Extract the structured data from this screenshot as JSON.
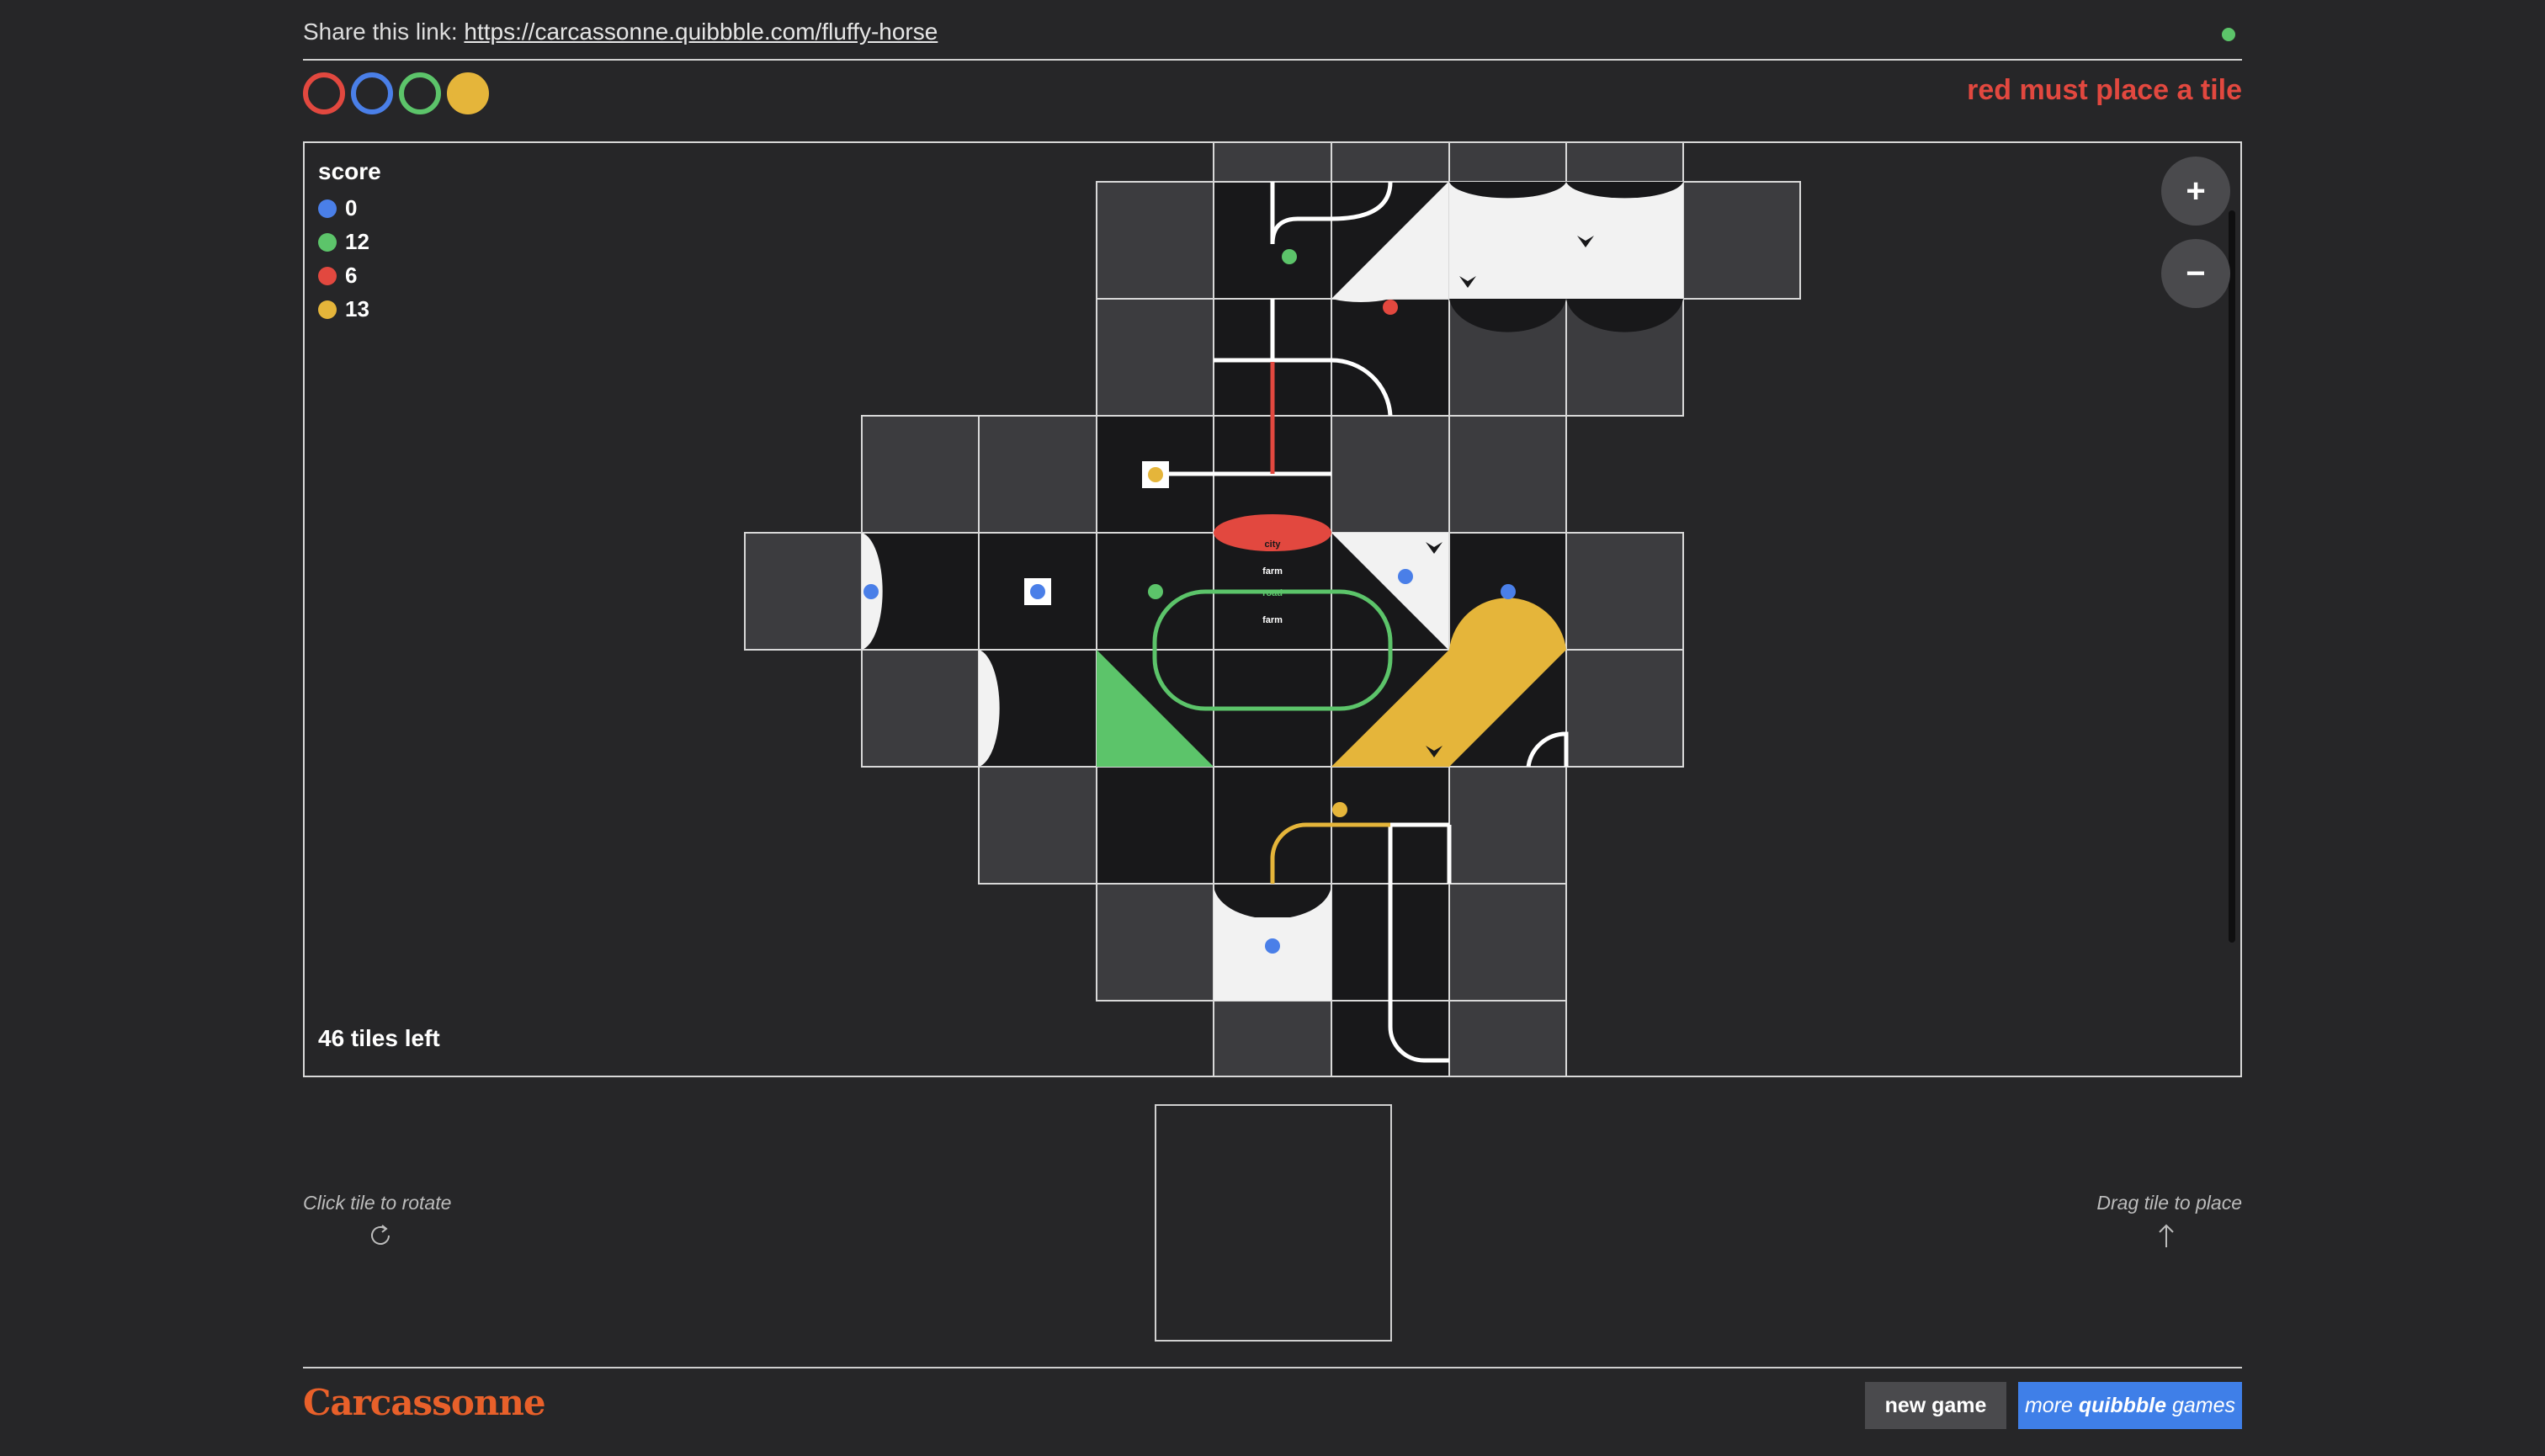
{
  "share": {
    "prefix": "Share this link: ",
    "url": "https://carcassonne.quibbble.com/fluffy-horse"
  },
  "players": [
    {
      "color": "red",
      "hex": "#e2483f",
      "filled": false
    },
    {
      "color": "blue",
      "hex": "#4a7fe8",
      "filled": false
    },
    {
      "color": "green",
      "hex": "#5cc46a",
      "filled": false
    },
    {
      "color": "yellow",
      "hex": "#e5b53a",
      "filled": true
    }
  ],
  "turn_message": "red must place a tile",
  "score": {
    "title": "score",
    "rows": [
      {
        "color": "#4a7fe8",
        "value": "0"
      },
      {
        "color": "#5cc46a",
        "value": "12"
      },
      {
        "color": "#e2483f",
        "value": "6"
      },
      {
        "color": "#e5b53a",
        "value": "13"
      }
    ]
  },
  "tiles_left": "46 tiles left",
  "zoom": {
    "in": "+",
    "out": "−"
  },
  "tile_labels": {
    "city": "city",
    "farm1": "farm",
    "road": "road",
    "farm2": "farm"
  },
  "hints": {
    "rotate": "Click tile to rotate",
    "place": "Drag tile to place"
  },
  "footer": {
    "logo": "Carcassonne",
    "new_game": "new game",
    "more_prefix": "more ",
    "more_brand": "quibbble",
    "more_suffix": " games"
  },
  "colors": {
    "red": "#e2483f",
    "blue": "#4a7fe8",
    "green": "#5cc46a",
    "yellow": "#e5b53a",
    "tile": "#18181a",
    "empty_slot": "#3c3c3f",
    "city": "#f2f2f2",
    "road": "#ffffff",
    "logo": "#e8602a",
    "accent_button": "#3f7fe8"
  }
}
